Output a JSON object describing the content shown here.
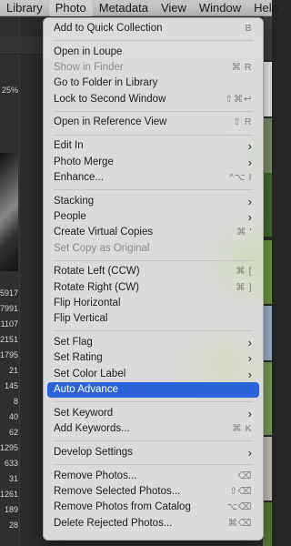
{
  "menubar": {
    "items": [
      "Library",
      "Photo",
      "Metadata",
      "View",
      "Window",
      "Help"
    ],
    "active": "Photo"
  },
  "app": {
    "zoom_readout": "25%",
    "numbers": [
      "5917",
      "7991",
      "1107",
      "2151",
      "1795",
      "21",
      "145",
      "8",
      "40",
      "62",
      "1295",
      "633",
      "31",
      "1261",
      "189",
      "28"
    ]
  },
  "photo_menu": {
    "items": [
      {
        "label": "Add to Quick Collection",
        "shortcut": "B"
      },
      {
        "sep": true
      },
      {
        "label": "Open in Loupe",
        "shortcut": ""
      },
      {
        "label": "Show in Finder",
        "shortcut": "⌘ R",
        "disabled": true
      },
      {
        "label": "Go to Folder in Library",
        "shortcut": ""
      },
      {
        "label": "Lock to Second Window",
        "shortcut": "⇧⌘↩"
      },
      {
        "sep": true
      },
      {
        "label": "Open in Reference View",
        "shortcut": "⇧ R"
      },
      {
        "sep": true
      },
      {
        "label": "Edit In",
        "submenu": true
      },
      {
        "label": "Photo Merge",
        "submenu": true
      },
      {
        "label": "Enhance...",
        "shortcut": "^⌥ I"
      },
      {
        "sep": true
      },
      {
        "label": "Stacking",
        "submenu": true
      },
      {
        "label": "People",
        "submenu": true
      },
      {
        "label": "Create Virtual Copies",
        "shortcut": "⌘ '"
      },
      {
        "label": "Set Copy as Original",
        "shortcut": "",
        "disabled": true
      },
      {
        "sep": true
      },
      {
        "label": "Rotate Left (CCW)",
        "shortcut": "⌘ ["
      },
      {
        "label": "Rotate Right (CW)",
        "shortcut": "⌘ ]"
      },
      {
        "label": "Flip Horizontal",
        "shortcut": ""
      },
      {
        "label": "Flip Vertical",
        "shortcut": ""
      },
      {
        "sep": true
      },
      {
        "label": "Set Flag",
        "submenu": true
      },
      {
        "label": "Set Rating",
        "submenu": true
      },
      {
        "label": "Set Color Label",
        "submenu": true
      },
      {
        "label": "Auto Advance",
        "shortcut": "",
        "highlight": true
      },
      {
        "sep": true
      },
      {
        "label": "Set Keyword",
        "submenu": true
      },
      {
        "label": "Add Keywords...",
        "shortcut": "⌘ K"
      },
      {
        "sep": true
      },
      {
        "label": "Develop Settings",
        "submenu": true
      },
      {
        "sep": true
      },
      {
        "label": "Remove Photos...",
        "shortcut": "⌫"
      },
      {
        "label": "Remove Selected Photos...",
        "shortcut": "⇧⌫"
      },
      {
        "label": "Remove Photos from Catalog",
        "shortcut": "⌥⌫"
      },
      {
        "label": "Delete Rejected Photos...",
        "shortcut": "⌘⌫"
      }
    ]
  },
  "icons": {
    "submenu": "chevron-right-icon"
  },
  "colors": {
    "highlight": "#2a64d8",
    "menu_bg": "#e4e2e4"
  }
}
